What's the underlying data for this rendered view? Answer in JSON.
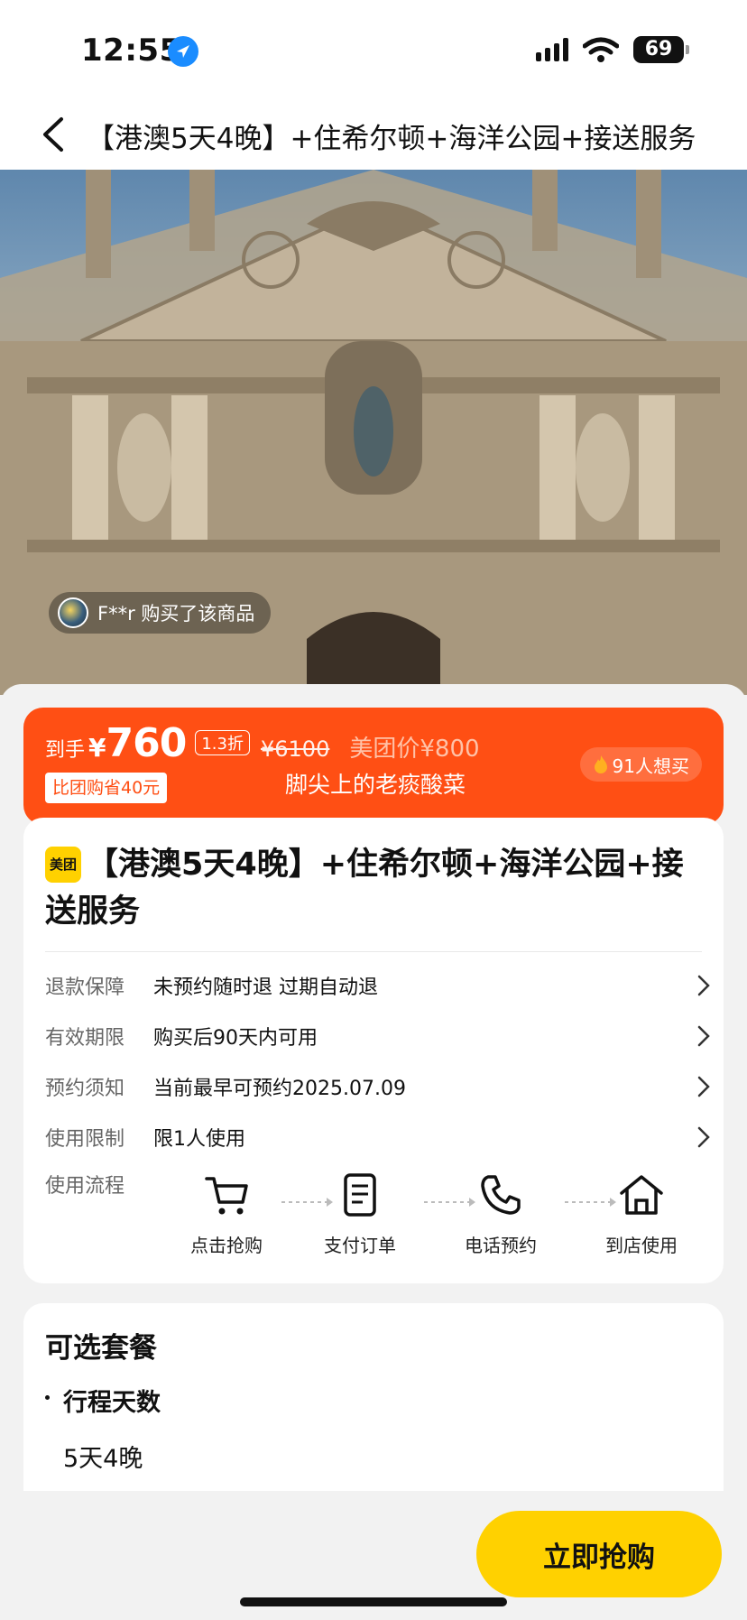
{
  "status_bar": {
    "time": "12:55",
    "battery": "69"
  },
  "nav": {
    "title": "【港澳5天4晚】+住希尔顿+海洋公园+接送服务"
  },
  "hero": {
    "buyer_text": "F**r 购买了该商品"
  },
  "price": {
    "label": "到手",
    "currency": "¥",
    "amount": "760",
    "discount": "1.3折",
    "original": "¥6100",
    "meituan_price": "美团价¥800",
    "save_tag": "比团购省40元",
    "shop_name": "脚尖上的老痰酸菜",
    "want": "91人想买"
  },
  "product": {
    "logo": "美团",
    "title": "【港澳5天4晚】+住希尔顿+海洋公园+接送服务",
    "rows": [
      {
        "label": "退款保障",
        "value": "未预约随时退 过期自动退"
      },
      {
        "label": "有效期限",
        "value": "购买后90天内可用"
      },
      {
        "label": "预约须知",
        "value": "当前最早可预约2025.07.09"
      },
      {
        "label": "使用限制",
        "value": "限1人使用"
      }
    ],
    "flow_label": "使用流程",
    "flow_steps": [
      {
        "label": "点击抢购",
        "icon": "cart-icon"
      },
      {
        "label": "支付订单",
        "icon": "document-icon"
      },
      {
        "label": "电话预约",
        "icon": "phone-icon"
      },
      {
        "label": "到店使用",
        "icon": "home-icon"
      }
    ]
  },
  "package": {
    "title": "可选套餐",
    "section": "行程天数",
    "option": "5天4晚"
  },
  "buy_button": "立即抢购",
  "colors": {
    "accent": "#ff4f14",
    "brand_yellow": "#ffd100"
  }
}
